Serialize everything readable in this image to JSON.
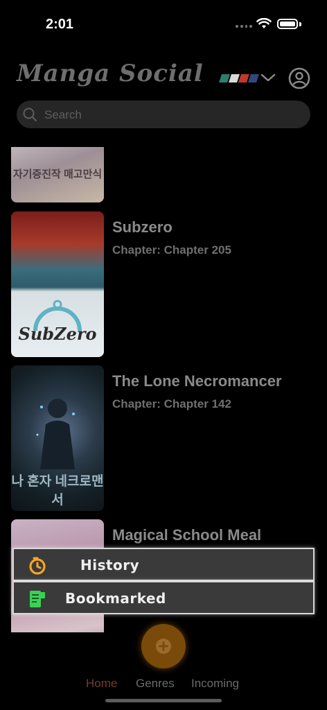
{
  "status": {
    "time": "2:01"
  },
  "header": {
    "logo_text": "Manga Social",
    "flag_colors": [
      "#2e7d6f",
      "#d9d9d9",
      "#c0392b",
      "#2e4a7d"
    ]
  },
  "search": {
    "placeholder": "Search"
  },
  "manga_list": [
    {
      "title": "",
      "chapter": "",
      "cover_text": "자기증진작 매고만식"
    },
    {
      "title": "Subzero",
      "chapter": "Chapter: Chapter 205",
      "cover_text": "SubZero"
    },
    {
      "title": "The Lone Necromancer",
      "chapter": "Chapter: Chapter 142",
      "cover_text": "나 혼자 네크로맨서"
    },
    {
      "title": "Magical School Meal",
      "chapter": "",
      "cover_text": ""
    }
  ],
  "popup_menu": {
    "history_label": "History",
    "bookmarked_label": "Bookmarked",
    "history_icon_color": "#f5a623",
    "bookmarked_icon_color": "#39d353"
  },
  "fab": {
    "icon": "plus-circle-icon"
  },
  "tabs": [
    {
      "label": "Home",
      "active": true
    },
    {
      "label": "Genres",
      "active": false
    },
    {
      "label": "Incoming",
      "active": false
    }
  ]
}
